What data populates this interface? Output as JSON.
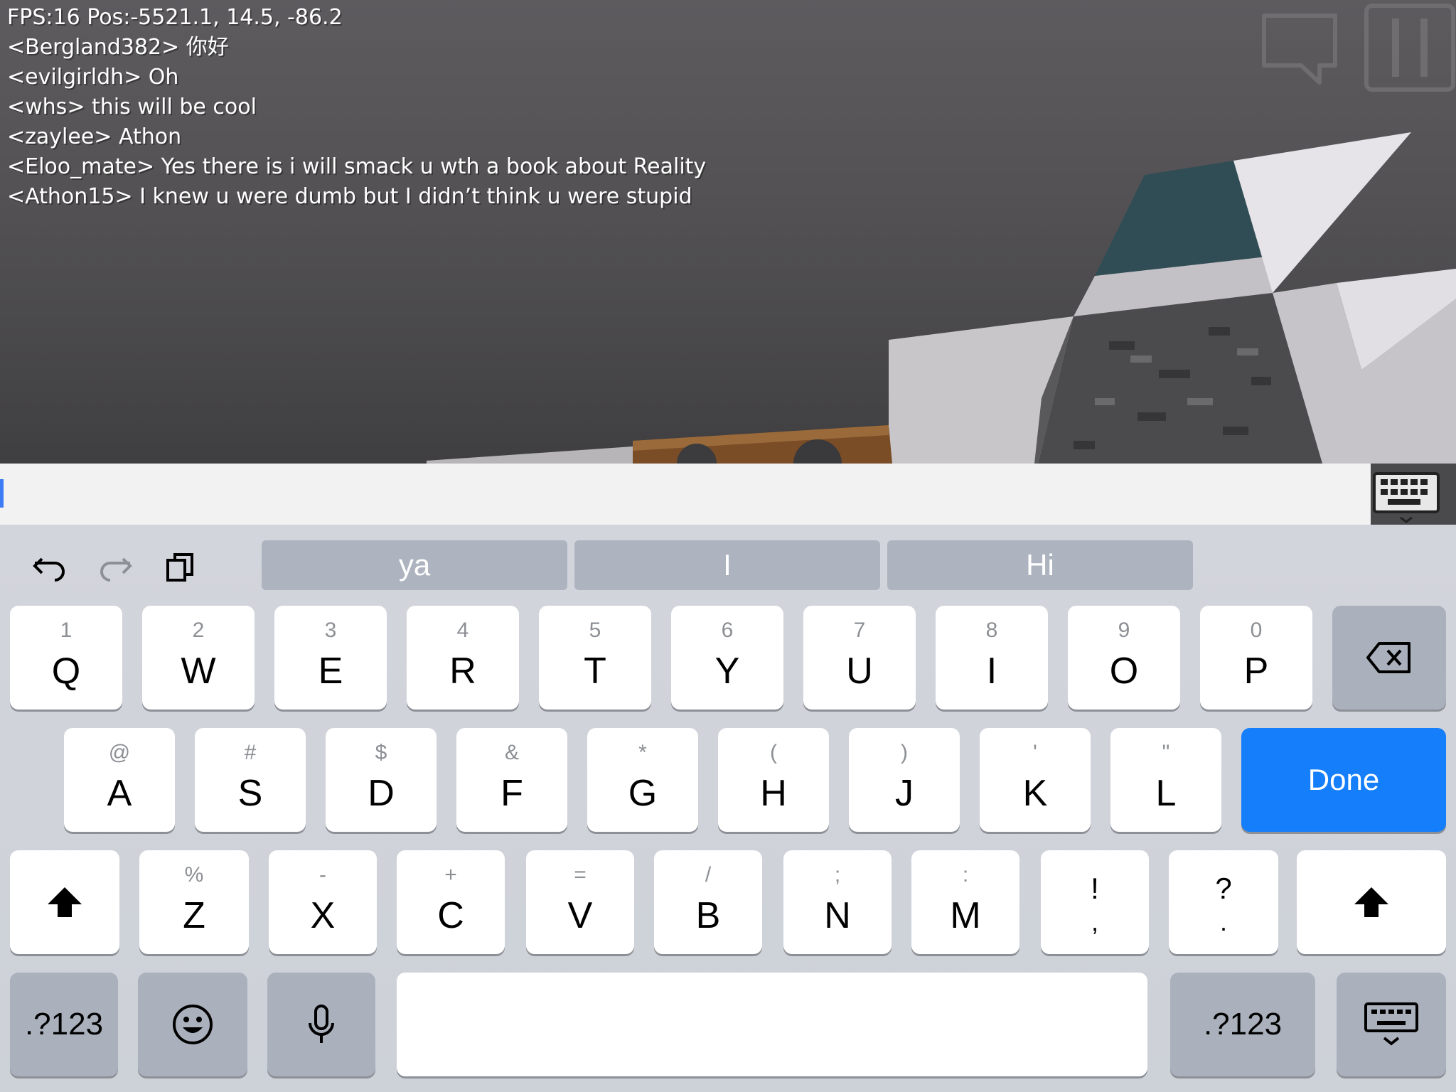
{
  "hud": {
    "fps_line": "FPS:16 Pos:-5521.1, 14.5, -86.2",
    "chat": [
      "<Bergland382> 你好",
      "<evilgirldh> Oh",
      "<whs> this will be cool",
      "<zaylee> Athon",
      "<Eloo_mate> Yes there is i will smack u wth a book about Reality",
      "<Athon15> I knew u were dumb but I didn’t think u were stupid"
    ]
  },
  "top_buttons": {
    "chat_icon": "speech-bubble-icon",
    "pause_icon": "pause-icon"
  },
  "chat_input": {
    "value": "",
    "placeholder": ""
  },
  "toolbar": {
    "undo_icon": "undo-icon",
    "redo_icon": "redo-icon",
    "paste_icon": "paste-icon"
  },
  "suggestions": [
    "ya",
    "I",
    "Hi"
  ],
  "rows": {
    "row1": [
      {
        "main": "Q",
        "sub": "1"
      },
      {
        "main": "W",
        "sub": "2"
      },
      {
        "main": "E",
        "sub": "3"
      },
      {
        "main": "R",
        "sub": "4"
      },
      {
        "main": "T",
        "sub": "5"
      },
      {
        "main": "Y",
        "sub": "6"
      },
      {
        "main": "U",
        "sub": "7"
      },
      {
        "main": "I",
        "sub": "8"
      },
      {
        "main": "O",
        "sub": "9"
      },
      {
        "main": "P",
        "sub": "0"
      }
    ],
    "row2": [
      {
        "main": "A",
        "sub": "@"
      },
      {
        "main": "S",
        "sub": "#"
      },
      {
        "main": "D",
        "sub": "$"
      },
      {
        "main": "F",
        "sub": "&"
      },
      {
        "main": "G",
        "sub": "*"
      },
      {
        "main": "H",
        "sub": "("
      },
      {
        "main": "J",
        "sub": ")"
      },
      {
        "main": "K",
        "sub": "'"
      },
      {
        "main": "L",
        "sub": "\""
      }
    ],
    "row3": [
      {
        "main": "Z",
        "sub": "%"
      },
      {
        "main": "X",
        "sub": "-"
      },
      {
        "main": "C",
        "sub": "+"
      },
      {
        "main": "V",
        "sub": "="
      },
      {
        "main": "B",
        "sub": "/"
      },
      {
        "main": "N",
        "sub": ";"
      },
      {
        "main": "M",
        "sub": ":"
      }
    ],
    "punct": [
      {
        "top": "!",
        "bottom": ","
      },
      {
        "top": "?",
        "bottom": "."
      }
    ]
  },
  "keys": {
    "done": "Done",
    "numbers_left": ".?123",
    "numbers_right": ".?123",
    "delete_icon": "backspace-icon",
    "shift_icon": "shift-icon",
    "emoji_icon": "emoji-icon",
    "mic_icon": "microphone-icon",
    "hide_keyboard_icon": "keyboard-dismiss-icon"
  },
  "colors": {
    "done_key": "#147efb",
    "cursor": "#3d7cf5"
  }
}
